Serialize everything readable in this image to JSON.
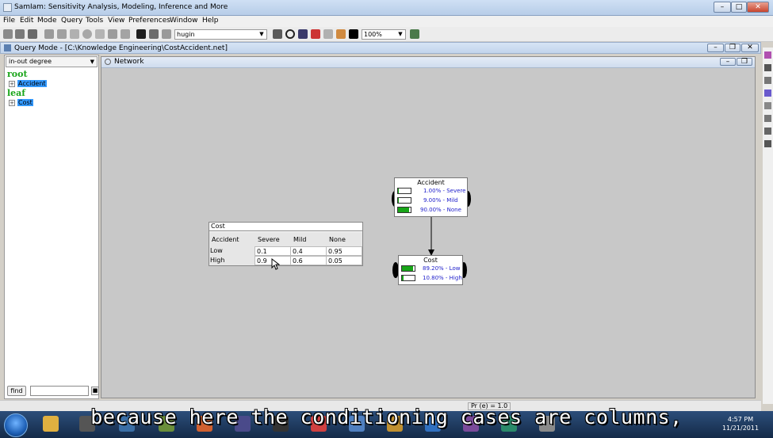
{
  "window": {
    "title": "SamIam: Sensitivity Analysis, Modeling, Inference and More"
  },
  "menu": [
    "File",
    "Edit",
    "Mode",
    "Query",
    "Tools",
    "View",
    "Preferences",
    "Window",
    "Help"
  ],
  "toolbar": {
    "algorithm": "hugin",
    "zoom": "100%"
  },
  "query_frame": {
    "title": "Query Mode - [C:\\Knowledge Engineering\\CostAccident.net]"
  },
  "left_panel": {
    "degree_select": "in-out degree",
    "root_label": "root",
    "root_items": [
      "Accident"
    ],
    "leaf_label": "leaf",
    "leaf_items": [
      "Cost"
    ],
    "find_label": "find"
  },
  "network_frame": {
    "title": "Network"
  },
  "cpt": {
    "title": "Cost",
    "corner": "Accident",
    "columns": [
      "Severe",
      "Mild",
      "None"
    ],
    "rows": [
      {
        "label": "Low",
        "values": [
          "0.1",
          "0.4",
          "0.95"
        ]
      },
      {
        "label": "High",
        "values": [
          "0.9",
          "0.6",
          "0.05"
        ]
      }
    ]
  },
  "nodes": {
    "accident": {
      "title": "Accident",
      "states": [
        {
          "text": "1.00% - Severe",
          "pct": 1.0
        },
        {
          "text": "9.00% - Mild",
          "pct": 9.0
        },
        {
          "text": "90.00% - None",
          "pct": 90.0
        }
      ]
    },
    "cost": {
      "title": "Cost",
      "states": [
        {
          "text": "89.20% - Low",
          "pct": 89.2
        },
        {
          "text": "10.80% - High",
          "pct": 10.8
        }
      ]
    }
  },
  "status": {
    "pr_e": "Pr (e) = 1.0"
  },
  "taskbar": {
    "time": "4:57 PM",
    "date": "11/21/2011"
  },
  "subtitle": "because here the conditioning cases are columns,",
  "colors": {
    "bar_fill": "#18a518",
    "state_text": "#2222cc",
    "tree_header": "#1aa51a",
    "selection": "#3399ff"
  }
}
